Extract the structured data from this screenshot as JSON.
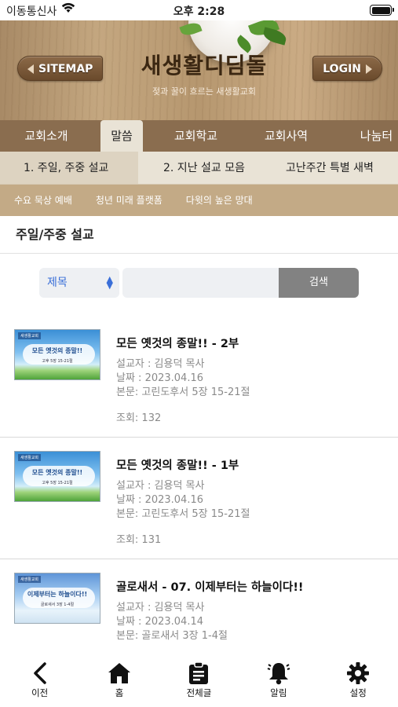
{
  "status": {
    "carrier": "이동통신사",
    "time": "오후 2:28"
  },
  "header": {
    "sitemap": "SITEMAP",
    "login": "LOGIN",
    "brand": "새생활디딤돌",
    "slogan": "젖과 꿀이 흐르는 새생활교회"
  },
  "menu1": [
    "교회소개",
    "말씀",
    "교회학교",
    "교회사역",
    "나눔터"
  ],
  "menu2": [
    "1. 주일, 주중 설교",
    "2. 지난 설교 모음",
    "고난주간 특별 새벽"
  ],
  "menu3": [
    "수요 묵상 예배",
    "청년 미래 플랫폼",
    "다윗의 높은 망대"
  ],
  "section_title": "주일/주중 설교",
  "search": {
    "field": "제목",
    "query": "",
    "button": "검색"
  },
  "sermons": [
    {
      "title": "모든 옛것의 종말!! - 2부",
      "preacher": "설교자 : 김용덕 목사",
      "date": "날짜 : 2023.04.16",
      "text": "본문: 고린도후서 5장 15-21절",
      "views": "조회: 132",
      "thumb_title": "모든 옛것의 종말!!",
      "thumb_sub": "고후 5장 15-21절",
      "thumb_logo": "새생활교회"
    },
    {
      "title": "모든 옛것의 종말!! - 1부",
      "preacher": "설교자 : 김용덕 목사",
      "date": "날짜 : 2023.04.16",
      "text": "본문: 고린도후서 5장 15-21절",
      "views": "조회: 131",
      "thumb_title": "모든 옛것의 종말!!",
      "thumb_sub": "고후 5장 15-21절",
      "thumb_logo": "새생활교회"
    },
    {
      "title": "골로새서 - 07. 이제부터는 하늘이다!!",
      "preacher": "설교자 : 김용덕 목사",
      "date": "날짜 : 2023.04.14",
      "text": "본문: 골로새서 3장 1-4절",
      "views": "",
      "thumb_title": "이제부터는 하늘이다!!",
      "thumb_sub": "골로새서 3장 1-4절",
      "thumb_logo": "새생활교회"
    }
  ],
  "tabbar": [
    {
      "label": "이전",
      "icon": "back-icon"
    },
    {
      "label": "홈",
      "icon": "home-icon"
    },
    {
      "label": "전체글",
      "icon": "clipboard-icon"
    },
    {
      "label": "알림",
      "icon": "bell-icon"
    },
    {
      "label": "설정",
      "icon": "gear-icon"
    }
  ]
}
